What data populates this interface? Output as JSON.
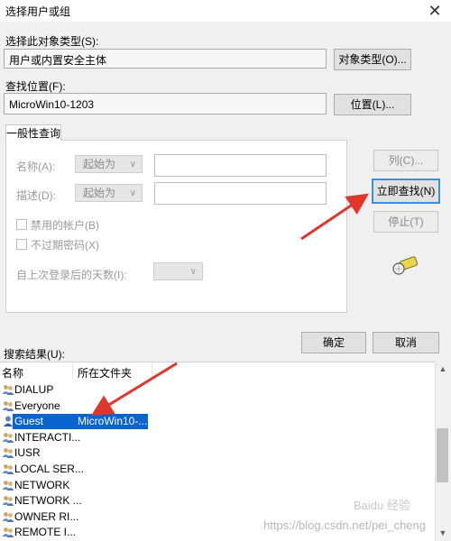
{
  "window": {
    "title": "选择用户或组",
    "close_glyph": "✕"
  },
  "object_type": {
    "label": "选择此对象类型(S):",
    "value": "用户或内置安全主体",
    "button": "对象类型(O)..."
  },
  "location": {
    "label": "查找位置(F):",
    "value": "MicroWin10-1203",
    "button": "位置(L)..."
  },
  "query_tab": {
    "label": "一般性查询"
  },
  "query": {
    "name_label": "名称(A):",
    "name_mode": "起始为",
    "desc_label": "描述(D):",
    "desc_mode": "起始为",
    "disabled_accounts": "禁用的帐户(B)",
    "non_expiring_pwd": "不过期密码(X)",
    "days_label": "自上次登录后的天数(I):"
  },
  "side_buttons": {
    "columns": "列(C)...",
    "find_now": "立即查找(N)",
    "stop": "停止(T)"
  },
  "dialog_buttons": {
    "ok": "确定",
    "cancel": "取消"
  },
  "results": {
    "label": "搜索结果(U):",
    "columns": [
      "名称",
      "所在文件夹"
    ],
    "rows": [
      {
        "name": "DIALUP",
        "folder": ""
      },
      {
        "name": "Everyone",
        "folder": ""
      },
      {
        "name": "Guest",
        "folder": "MicroWin10-...",
        "selected": true
      },
      {
        "name": "INTERACTI...",
        "folder": ""
      },
      {
        "name": "IUSR",
        "folder": ""
      },
      {
        "name": "LOCAL SER...",
        "folder": ""
      },
      {
        "name": "NETWORK",
        "folder": ""
      },
      {
        "name": "NETWORK ...",
        "folder": ""
      },
      {
        "name": "OWNER RI...",
        "folder": ""
      },
      {
        "name": "REMOTE I...",
        "folder": ""
      }
    ]
  },
  "watermark": {
    "text": "https://blog.csdn.net/pei_cheng",
    "logo_text": "Baidu 经验"
  },
  "colors": {
    "selection": "#0a64d0",
    "arrow": "#e0362c",
    "default_button_border": "#3c8fe0"
  }
}
